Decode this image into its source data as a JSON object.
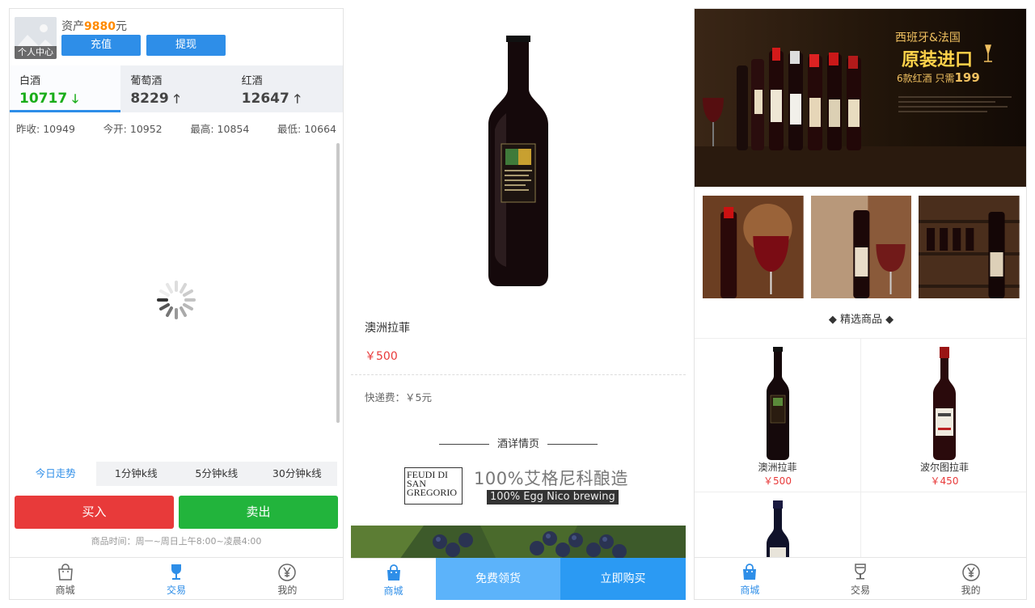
{
  "p1": {
    "assets_prefix": "资产",
    "assets_value": "9880",
    "assets_suffix": "元",
    "avatar_caption": "个人中心",
    "recharge": "充值",
    "withdraw": "提现",
    "markets": [
      {
        "name": "白酒",
        "value": "10717",
        "arrow": "🡓"
      },
      {
        "name": "葡萄酒",
        "value": "8229",
        "arrow": "🡑"
      },
      {
        "name": "红酒",
        "value": "12647",
        "arrow": "🡑"
      }
    ],
    "stats": [
      {
        "label": "昨收:",
        "value": "10949"
      },
      {
        "label": "今开:",
        "value": "10952"
      },
      {
        "label": "最高:",
        "value": "10854"
      },
      {
        "label": "最低:",
        "value": "10664"
      }
    ],
    "periods": [
      "今日走势",
      "1分钟k线",
      "5分钟k线",
      "30分钟k线"
    ],
    "buy": "买入",
    "sell": "卖出",
    "hours": "商品时间：周一~周日上午8:00~凌晨4:00",
    "nav": [
      "商城",
      "交易",
      "我的"
    ]
  },
  "p2": {
    "name": "澳洲拉菲",
    "price": "￥500",
    "shipping": "快递费：￥5元",
    "detail_heading": "酒详情页",
    "brand_box": "FEUDI DI SAN GREGORIO",
    "brand_cn": "100%艾格尼科酿造",
    "brand_en": "100% Egg Nico brewing",
    "bottle_label": "FEUDI SAN GREGORIO",
    "nav_home": "商城",
    "free": "免费领货",
    "buy_now": "立即购买"
  },
  "p3": {
    "banner_line1": "西班牙&法国",
    "banner_line2": "原装进口",
    "banner_line3_prefix": "6款红酒 只需",
    "banner_line3_price": "199",
    "featured": "◆ 精选商品 ◆",
    "products": [
      {
        "name": "澳洲拉菲",
        "price": "￥500"
      },
      {
        "name": "波尔图拉菲",
        "price": "￥450"
      }
    ],
    "nav": [
      "商城",
      "交易",
      "我的"
    ]
  },
  "colors": {
    "accent": "#2e8ee8",
    "up": "#1aad19",
    "price": "#e83a3a",
    "assets": "#ff8a00",
    "buy": "#e83a3a",
    "sell": "#22b43c"
  }
}
